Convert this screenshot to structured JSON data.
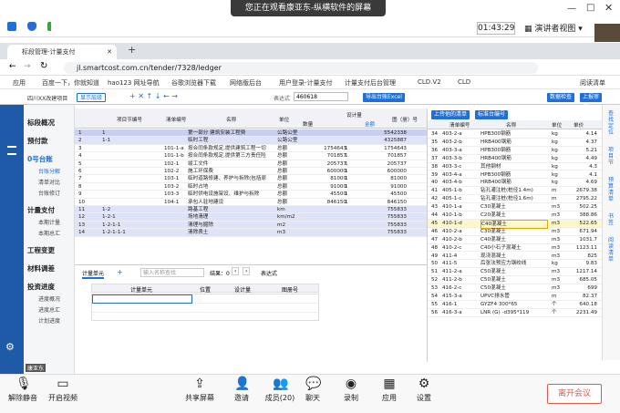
{
  "meeting_top": {
    "share_banner": "您正在观看康亚东-纵横软件的屏幕",
    "timer": "01:43:29",
    "presenter_view": "演讲者视图"
  },
  "browser": {
    "tab_title": "标段管理-计量支付",
    "url": "jl.smartcost.com.cn/tender/7328/ledger",
    "bookmarks": [
      "应用",
      "百度一下，你就知道",
      "hao123 网址导航",
      "谷歌浏览器下载",
      "网络版后台",
      "用户登录-计量支付",
      "计量支付后台管理",
      "CLD.V2",
      "CLD",
      "阅读清单"
    ]
  },
  "app": {
    "project": "四川XX改建项目",
    "toolbar": [
      "显示层级",
      "表达式",
      "460618"
    ],
    "export_btn": "导出台账Excel",
    "right_btns": [
      "数据检查",
      "上报审批"
    ]
  },
  "sidebar": {
    "items": [
      {
        "label": "标段概况",
        "sub": []
      },
      {
        "label": "预付款",
        "sub": []
      },
      {
        "label": "0号台账",
        "sub": [
          "台账分解",
          "清单对比",
          "台账修订"
        ]
      },
      {
        "label": "计量支付",
        "sub": [
          "本期计量",
          "本期总汇"
        ]
      },
      {
        "label": "工程变更",
        "sub": []
      },
      {
        "label": "材料调差",
        "sub": []
      },
      {
        "label": "投资进度",
        "sub": [
          "进度概况",
          "进度总汇",
          "计划进度"
        ]
      }
    ],
    "user": "康亚东"
  },
  "grid": {
    "headers": [
      "项目节编号",
      "清单编号",
      "名称",
      "单位",
      "数量",
      "设计量",
      "金额",
      "图（册）号"
    ],
    "rows": [
      {
        "n": "1",
        "code": "1",
        "bill": "",
        "name": "第一部分 建筑安装工程费",
        "unit": "公路公里",
        "qty": "",
        "design": "",
        "amt": "5542338",
        "cls": "sum"
      },
      {
        "n": "2",
        "code": "1-1",
        "bill": "",
        "name": "临时工程",
        "unit": "公路公里",
        "qty": "",
        "design": "",
        "amt": "4325887",
        "cls": "sel"
      },
      {
        "n": "3",
        "code": "",
        "bill": "101-1-a",
        "name": "按合同条款规定,提供建筑工程一切",
        "unit": "总额",
        "qty": "1754643",
        "design": "1",
        "amt": "1754643",
        "cls": ""
      },
      {
        "n": "4",
        "code": "",
        "bill": "101-1-b",
        "name": "按合同条款规定,提供第三方责任险",
        "unit": "总额",
        "qty": "701857",
        "design": "1",
        "amt": "701857",
        "cls": ""
      },
      {
        "n": "5",
        "code": "",
        "bill": "102-1",
        "name": "竣工文件",
        "unit": "总额",
        "qty": "205737",
        "design": "1",
        "amt": "205737",
        "cls": ""
      },
      {
        "n": "6",
        "code": "",
        "bill": "102-2",
        "name": "施工环保费",
        "unit": "总额",
        "qty": "600000",
        "design": "1",
        "amt": "600000",
        "cls": ""
      },
      {
        "n": "7",
        "code": "",
        "bill": "103-1",
        "name": "临时道路修建、养护与拆除(包括原",
        "unit": "总额",
        "qty": "81000",
        "design": "1",
        "amt": "81000",
        "cls": ""
      },
      {
        "n": "8",
        "code": "",
        "bill": "103-2",
        "name": "临时占地",
        "unit": "总额",
        "qty": "91000",
        "design": "1",
        "amt": "91000",
        "cls": ""
      },
      {
        "n": "9",
        "code": "",
        "bill": "103-3",
        "name": "临时供电设施架设、维护与拆除",
        "unit": "总额",
        "qty": "45500",
        "design": "1",
        "amt": "45500",
        "cls": ""
      },
      {
        "n": "10",
        "code": "",
        "bill": "104-1",
        "name": "承包人驻地建设",
        "unit": "总额",
        "qty": "846150",
        "design": "1",
        "amt": "846150",
        "cls": ""
      },
      {
        "n": "11",
        "code": "1-2",
        "bill": "",
        "name": "路基工程",
        "unit": "km",
        "qty": "",
        "design": "",
        "amt": "755833",
        "cls": "sel"
      },
      {
        "n": "12",
        "code": "1-2-1",
        "bill": "",
        "name": "场地清理",
        "unit": "km/m2",
        "qty": "",
        "design": "",
        "amt": "755833",
        "cls": "sel"
      },
      {
        "n": "13",
        "code": "1-2-1-1",
        "bill": "",
        "name": "清理与掘除",
        "unit": "m2",
        "qty": "",
        "design": "",
        "amt": "755833",
        "cls": "sel"
      },
      {
        "n": "14",
        "code": "1-2-1-1-1",
        "bill": "",
        "name": "清除表土",
        "unit": "m3",
        "qty": "",
        "design": "",
        "amt": "755833",
        "cls": "sel"
      }
    ]
  },
  "lower": {
    "tabs": [
      "计量单元"
    ],
    "search_placeholder": "输入名称查找",
    "result": "结果：0",
    "expr": "表达式",
    "headers": [
      "计量单元",
      "位置",
      "设计量",
      "图册号"
    ]
  },
  "rpanel": {
    "tabs": [
      "上传他的清单",
      "标准台编号"
    ],
    "headers": [
      "清单编号",
      "名称",
      "单位",
      "单价"
    ],
    "rows": [
      {
        "n": "34",
        "code": "403-2-a",
        "name": "HPB300钢筋",
        "unit": "kg",
        "price": "4.14"
      },
      {
        "n": "35",
        "code": "403-2-b",
        "name": "HRB400钢筋",
        "unit": "kg",
        "price": "4.37"
      },
      {
        "n": "36",
        "code": "403-3-a",
        "name": "HPB300钢筋",
        "unit": "kg",
        "price": "5.21"
      },
      {
        "n": "37",
        "code": "403-3-b",
        "name": "HRB400钢筋",
        "unit": "kg",
        "price": "4.49"
      },
      {
        "n": "38",
        "code": "403-3-c",
        "name": "其他钢材",
        "unit": "kg",
        "price": "4.3"
      },
      {
        "n": "39",
        "code": "403-4-a",
        "name": "HPB300钢筋",
        "unit": "kg",
        "price": "4.1"
      },
      {
        "n": "40",
        "code": "403-4-b",
        "name": "HRB400钢筋",
        "unit": "kg",
        "price": "4.69"
      },
      {
        "n": "41",
        "code": "405-1-b",
        "name": "钻孔灌注桩(桩径1.4m)",
        "unit": "m",
        "price": "2679.38"
      },
      {
        "n": "42",
        "code": "405-1-c",
        "name": "钻孔灌注桩(桩径1.6m)",
        "unit": "m",
        "price": "2795.22"
      },
      {
        "n": "43",
        "code": "410-1-a",
        "name": "C30混凝土",
        "unit": "m3",
        "price": "502.25"
      },
      {
        "n": "44",
        "code": "410-1-b",
        "name": "C20混凝土",
        "unit": "m3",
        "price": "388.86"
      },
      {
        "n": "45",
        "code": "410-1-d",
        "name": "C40混凝土",
        "unit": "m3",
        "price": "522.65",
        "hl": true
      },
      {
        "n": "46",
        "code": "410-2-a",
        "name": "C30混凝土",
        "unit": "m3",
        "price": "671.94"
      },
      {
        "n": "47",
        "code": "410-2-b",
        "name": "C40混凝土",
        "unit": "m3",
        "price": "1031.7"
      },
      {
        "n": "48",
        "code": "410-2-c",
        "name": "C40小石子混凝土",
        "unit": "m3",
        "price": "1123.11"
      },
      {
        "n": "49",
        "code": "411-4",
        "name": "现浇混凝土",
        "unit": "m3",
        "price": "825"
      },
      {
        "n": "50",
        "code": "411-5",
        "name": "后张法预应力钢绞线",
        "unit": "kg",
        "price": "9.83"
      },
      {
        "n": "51",
        "code": "411-2-a",
        "name": "C50混凝土",
        "unit": "m3",
        "price": "1217.14"
      },
      {
        "n": "52",
        "code": "411-2-b",
        "name": "C50混凝土",
        "unit": "m3",
        "price": "685.05"
      },
      {
        "n": "53",
        "code": "416-2-c",
        "name": "C50混凝土",
        "unit": "m3",
        "price": "699"
      },
      {
        "n": "54",
        "code": "415-3-a",
        "name": "UPVC排水管",
        "unit": "m",
        "price": "82.37"
      },
      {
        "n": "55",
        "code": "416-1",
        "name": "GYZF4 300*65",
        "unit": "个",
        "price": "640.18"
      },
      {
        "n": "56",
        "code": "416-3-a",
        "name": "LNR (G) -d395*119",
        "unit": "个",
        "price": "2231.49"
      }
    ]
  },
  "rright": [
    "查找定位",
    "项目节",
    "预算清单",
    "书签",
    "阅读清单"
  ],
  "meeting_bottom": {
    "buttons": [
      "解除静音",
      "开启视频",
      "共享屏幕",
      "邀请",
      "成员(20)",
      "聊天",
      "录制",
      "应用",
      "设置"
    ],
    "leave": "离开会议"
  },
  "colors": {
    "brand": "#1e5aa8",
    "accent": "#1e6fd9",
    "leave": "#e05a4a"
  }
}
